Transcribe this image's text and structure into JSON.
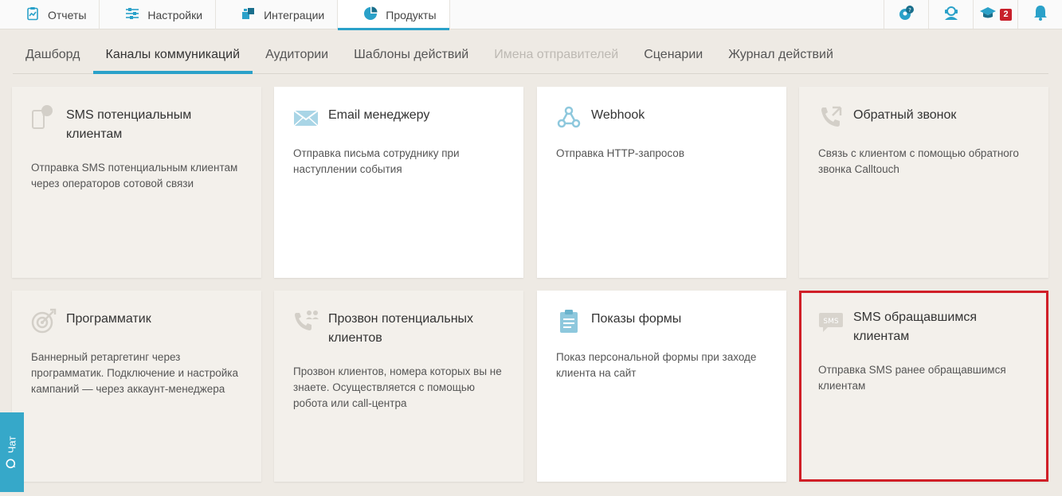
{
  "top_tabs": [
    {
      "label": "Отчеты",
      "icon": "clipboard-chart-icon"
    },
    {
      "label": "Настройки",
      "icon": "sliders-icon"
    },
    {
      "label": "Интеграции",
      "icon": "puzzle-icon"
    },
    {
      "label": "Продукты",
      "icon": "pie-chart-icon"
    }
  ],
  "top_icons": {
    "support": "support-chat-icon",
    "manager": "headset-icon",
    "education": "graduation-cap-icon",
    "education_badge": "2",
    "notifications": "bell-icon"
  },
  "subnav": [
    {
      "label": "Дашборд"
    },
    {
      "label": "Каналы коммуникаций"
    },
    {
      "label": "Аудитории"
    },
    {
      "label": "Шаблоны действий"
    },
    {
      "label": "Имена отправителей"
    },
    {
      "label": "Сценарии"
    },
    {
      "label": "Журнал действий"
    }
  ],
  "cards": [
    {
      "title": "SMS потенциальным клиентам",
      "desc": "Отправка SMS потенциальным клиентам через операторов сотовой связи",
      "icon": "sms-phone-icon"
    },
    {
      "title": "Email менеджеру",
      "desc": "Отправка письма сотруднику при наступлении события",
      "icon": "envelope-icon"
    },
    {
      "title": "Webhook",
      "desc": "Отправка HTTP-запросов",
      "icon": "webhook-icon"
    },
    {
      "title": "Обратный звонок",
      "desc": "Связь с клиентом с помощью обратного звонка Calltouch",
      "icon": "callback-icon"
    },
    {
      "title": "Программатик",
      "desc": "Баннерный ретаргетинг через программатик. Подключение и настройка кампаний — через аккаунт-менеджера",
      "icon": "target-icon"
    },
    {
      "title": "Прозвон потенциальных клиентов",
      "desc": "Прозвон клиентов, номера которых вы не знаете. Осуществляется с помощью робота или call-центра",
      "icon": "phone-people-icon"
    },
    {
      "title": "Показы формы",
      "desc": "Показ персональной формы при заходе клиента на сайт",
      "icon": "form-icon"
    },
    {
      "title": "SMS обращавшимся клиентам",
      "desc": "Отправка SMS ранее обращавшимся клиентам",
      "icon": "sms-bubble-icon",
      "sms_label": "SMS"
    }
  ],
  "chat": {
    "label": "Чат"
  },
  "colors": {
    "accent": "#2aa1c9",
    "highlight": "#d01f27",
    "badge": "#c8202b"
  }
}
